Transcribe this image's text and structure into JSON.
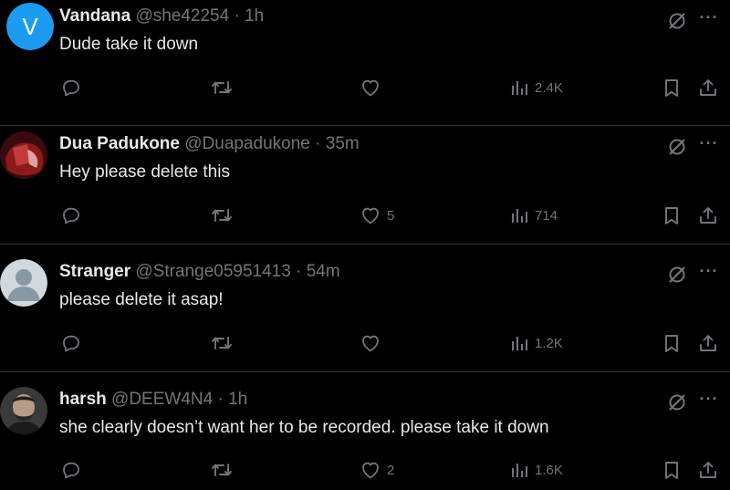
{
  "tweets": [
    {
      "name": "Vandana",
      "handle": "@she42254",
      "separator": "·",
      "time": "1h",
      "text": "Dude take it down",
      "avatar": {
        "type": "initial",
        "letter": "V",
        "color": "#1d9bf0"
      },
      "likes": "",
      "views": "2.4K"
    },
    {
      "name": "Dua Padukone",
      "handle": "@Duapadukone",
      "separator": "·",
      "time": "35m",
      "text": "Hey please delete this",
      "avatar": {
        "type": "photo",
        "color": "#8b1a1a"
      },
      "likes": "5",
      "views": "714"
    },
    {
      "name": "Stranger",
      "handle": "@Strange05951413",
      "separator": "·",
      "time": "54m",
      "text": "please delete it asap!",
      "avatar": {
        "type": "default",
        "color": "#cfd9de"
      },
      "likes": "",
      "views": "1.2K"
    },
    {
      "name": "harsh",
      "handle": "@DEEW4N4",
      "separator": "·",
      "time": "1h",
      "text": "she clearly doesn’t want her to be recorded. please take it down",
      "avatar": {
        "type": "photo",
        "color": "#5a5a5a"
      },
      "likes": "2",
      "views": "1.6K"
    }
  ],
  "icons": {
    "reply": "reply-icon",
    "retweet": "retweet-icon",
    "like": "heart-icon",
    "views": "views-chart-icon",
    "bookmark": "bookmark-icon",
    "share": "share-icon",
    "grok": "grok-icon",
    "more": "more-icon"
  },
  "colors": {
    "background": "#000000",
    "text": "#e7e9ea",
    "muted": "#71767b",
    "divider": "#2f3336"
  }
}
